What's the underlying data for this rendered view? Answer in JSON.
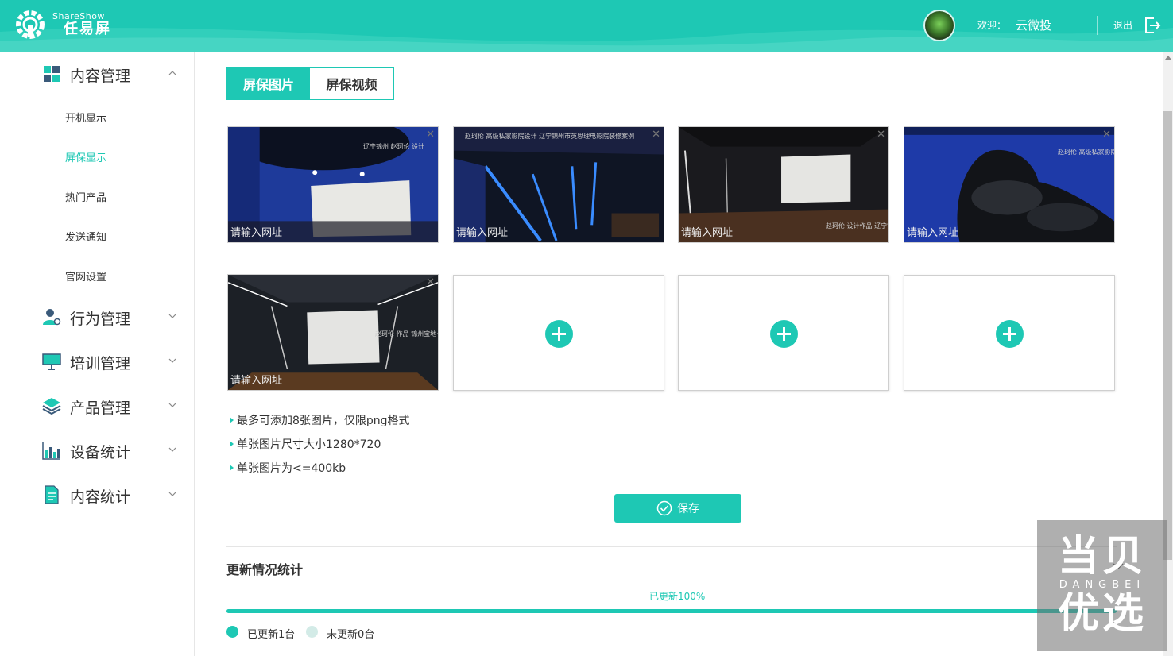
{
  "header": {
    "brand_en": "ShareShow",
    "brand_cn": "任易屏",
    "welcome": "欢迎：",
    "username": "云微投",
    "logout": "退出"
  },
  "sidebar": {
    "groups": [
      {
        "label": "内容管理",
        "icon": "content-grid-icon",
        "expanded": true
      },
      {
        "label": "行为管理",
        "icon": "user-gear-icon",
        "expanded": false
      },
      {
        "label": "培训管理",
        "icon": "presentation-board-icon",
        "expanded": false
      },
      {
        "label": "产品管理",
        "icon": "layers-icon",
        "expanded": false
      },
      {
        "label": "设备统计",
        "icon": "bar-stats-icon",
        "expanded": false
      },
      {
        "label": "内容统计",
        "icon": "document-icon",
        "expanded": false
      }
    ],
    "sub_items": [
      "开机显示",
      "屏保显示",
      "热门产品",
      "发送通知",
      "官网设置"
    ],
    "active_sub": "屏保显示"
  },
  "tabs": [
    "屏保图片",
    "屏保视频"
  ],
  "active_tab": "屏保图片",
  "images": [
    {
      "placeholder": "请输入网址",
      "caption": "辽宁锦州 赵珂伦 设计"
    },
    {
      "placeholder": "请输入网址",
      "caption": "赵珂伦 高级私家影院设计 辽宁锦州市英思理电影院装修案例"
    },
    {
      "placeholder": "请输入网址",
      "caption": "赵珂伦 设计作品 辽宁锦州铭源小镇"
    },
    {
      "placeholder": "请输入网址",
      "caption": "赵珂伦 高级私家影院设计 辽宁锦州铭源小镇别墅影院项目"
    },
    {
      "placeholder": "请输入网址",
      "caption": "赵珂伦 作品 锦州宝地·宝地别墅"
    }
  ],
  "add_slots": 3,
  "notes": [
    "最多可添加8张图片，仅限png格式",
    "单张图片尺寸大小1280*720",
    "单张图片为<=400kb"
  ],
  "save_label": "保存",
  "stats": {
    "title": "更新情况统计",
    "progress_text": "已更新100%",
    "progress": 1.0,
    "updated_label": "已更新1台",
    "not_updated_label": "未更新0台"
  },
  "colors": {
    "accent": "#1ec8b4",
    "legend_pending": "#d3ebe7"
  },
  "watermark": {
    "top": "当贝",
    "en": "DANGBEI",
    "bottom": "优选"
  }
}
